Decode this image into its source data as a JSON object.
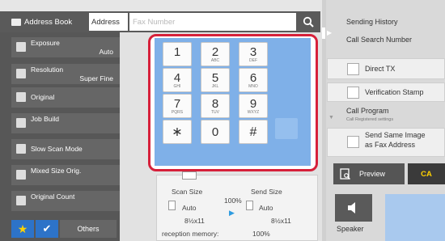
{
  "header": {
    "address_book": "Address Book",
    "address_tab": "Address",
    "fax_placeholder": "Fax Number"
  },
  "sidebar": {
    "items": [
      {
        "label": "Exposure",
        "value": "Auto"
      },
      {
        "label": "Resolution",
        "value": "Super Fine"
      },
      {
        "label": "Original",
        "value": ""
      },
      {
        "label": "Job Build",
        "value": ""
      },
      {
        "label": "Slow Scan Mode",
        "value": ""
      },
      {
        "label": "Mixed Size Orig.",
        "value": ""
      },
      {
        "label": "Original Count",
        "value": ""
      }
    ],
    "others": "Others"
  },
  "keypad": {
    "keys": [
      {
        "digit": "1",
        "sub": ""
      },
      {
        "digit": "2",
        "sub": "ABC"
      },
      {
        "digit": "3",
        "sub": "DEF"
      },
      {
        "digit": "4",
        "sub": "GHI"
      },
      {
        "digit": "5",
        "sub": "JKL"
      },
      {
        "digit": "6",
        "sub": "MNO"
      },
      {
        "digit": "7",
        "sub": "PQRS"
      },
      {
        "digit": "8",
        "sub": "TUV"
      },
      {
        "digit": "9",
        "sub": "WXYZ"
      },
      {
        "digit": "∗",
        "sub": ""
      },
      {
        "digit": "0",
        "sub": ""
      },
      {
        "digit": "#",
        "sub": ""
      }
    ]
  },
  "scan_info": {
    "scan_size_label": "Scan Size",
    "send_size_label": "Send Size",
    "ratio": "100%",
    "scan_auto": "Auto",
    "send_auto": "Auto",
    "scan_paper": "8½x11",
    "send_paper": "8½x11",
    "memory_label": "reception memory:",
    "memory_value": "100%"
  },
  "right_panel": {
    "sending_history": "Sending History",
    "call_search": "Call Search Number",
    "direct_tx": "Direct TX",
    "verification_stamp": "Verification Stamp",
    "call_program": "Call Program",
    "call_program_sub": "Call Registered settings",
    "send_same_image": "Send Same Image",
    "as_fax_address": "as Fax Address",
    "preview": "Preview",
    "ca": "CA",
    "speaker": "Speaker"
  },
  "colors": {
    "highlight_frame": "#d6203a",
    "keypad_bg": "#7fb0e8",
    "accent_blue": "#2d73c8",
    "star_yellow": "#ffd200"
  }
}
